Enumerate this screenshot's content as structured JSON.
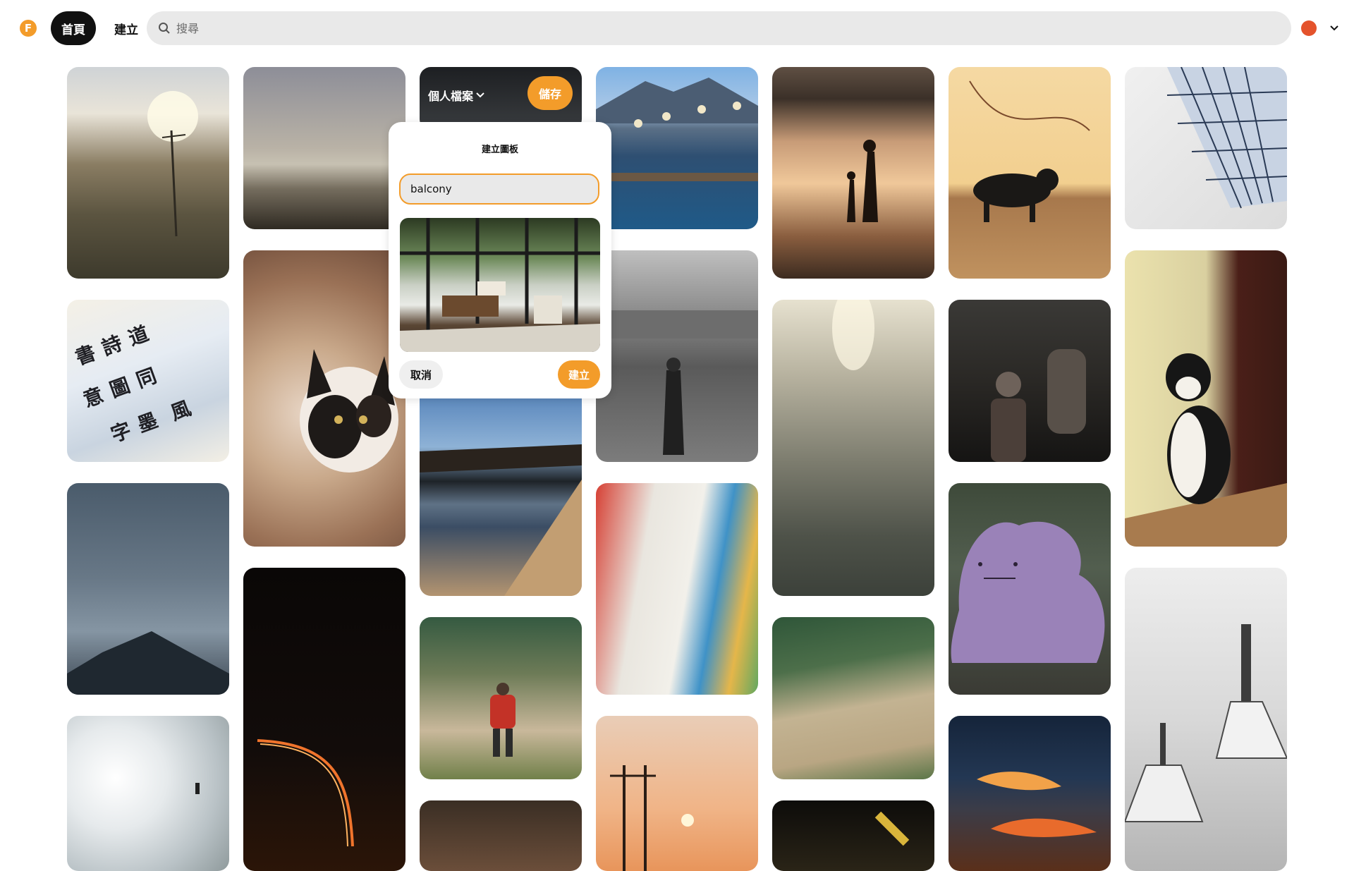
{
  "header": {
    "logo_letter": "F",
    "home_label": "首頁",
    "create_label": "建立",
    "search_placeholder": "搜尋",
    "avatar_color": "#e4532c",
    "brand_color": "#f39c2a"
  },
  "pin_overlay": {
    "board_label": "個人檔案",
    "save_label": "儲存"
  },
  "create_board_popover": {
    "title": "建立圖板",
    "board_name_value": "balcony",
    "cancel_label": "取消",
    "create_label": "建立"
  },
  "pins": [
    {
      "subject": "sunlit hillside with grasses and utility pole"
    },
    {
      "subject": "dusky sea horizon"
    },
    {
      "subject": "dark photo behind overlay"
    },
    {
      "subject": "harbor pier with lanterns and mountains"
    },
    {
      "subject": "silhouettes of adult and child in sunset water"
    },
    {
      "subject": "black cat on wooden deck under vine"
    },
    {
      "subject": "skylight window grid"
    },
    {
      "subject": "Chinese calligraphy scrolls"
    },
    {
      "subject": "calico cat lying on blanket"
    },
    {
      "subject": "monk walking on stone plaza, black and white"
    },
    {
      "subject": "sunlit rippling water"
    },
    {
      "subject": "young monks in shadowed room"
    },
    {
      "subject": "black and white cat by doorway"
    },
    {
      "subject": "misty mountain peak under cloudy sky"
    },
    {
      "subject": "lakeside shore with town at blue hour"
    },
    {
      "subject": "colorful prayer flags"
    },
    {
      "subject": "purple blob plush toy"
    },
    {
      "subject": "snowy hillside with lone hiker"
    },
    {
      "subject": "night highway light trails"
    },
    {
      "subject": "hiker in red jacket on grassy slope"
    },
    {
      "subject": "power lines at sunset"
    },
    {
      "subject": "alpine grassy mountain slope"
    },
    {
      "subject": "sunset clouds over dark sky"
    },
    {
      "subject": "white stupas in grayscale"
    },
    {
      "subject": "partial dark photo"
    },
    {
      "subject": "partial night sign photo"
    }
  ]
}
